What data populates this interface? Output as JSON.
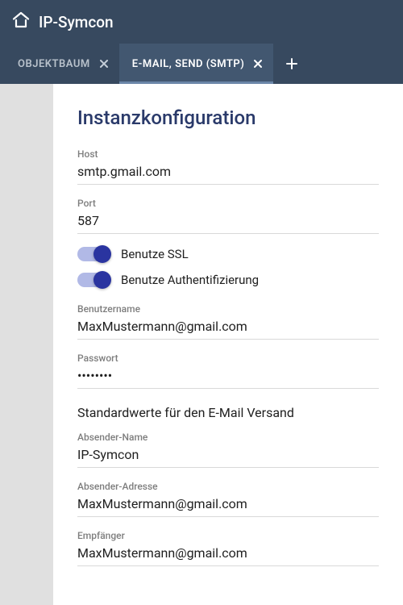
{
  "header": {
    "title": "IP-Symcon"
  },
  "tabs": [
    {
      "label": "OBJEKTBAUM",
      "active": false
    },
    {
      "label": "E-MAIL, SEND (SMTP)",
      "active": true
    }
  ],
  "panel": {
    "title": "Instanzkonfiguration"
  },
  "fields": {
    "host_label": "Host",
    "host_value": "smtp.gmail.com",
    "port_label": "Port",
    "port_value": "587",
    "ssl_label": "Benutze SSL",
    "auth_label": "Benutze Authentifizierung",
    "username_label": "Benutzername",
    "username_value": "MaxMustermann@gmail.com",
    "password_label": "Passwort",
    "password_value": "••••••••",
    "defaults_text": "Standardwerte für den E-Mail Versand",
    "sender_name_label": "Absender-Name",
    "sender_name_value": "IP-Symcon",
    "sender_addr_label": "Absender-Adresse",
    "sender_addr_value": "MaxMustermann@gmail.com",
    "recipient_label": "Empfänger",
    "recipient_value": "MaxMustermann@gmail.com"
  }
}
